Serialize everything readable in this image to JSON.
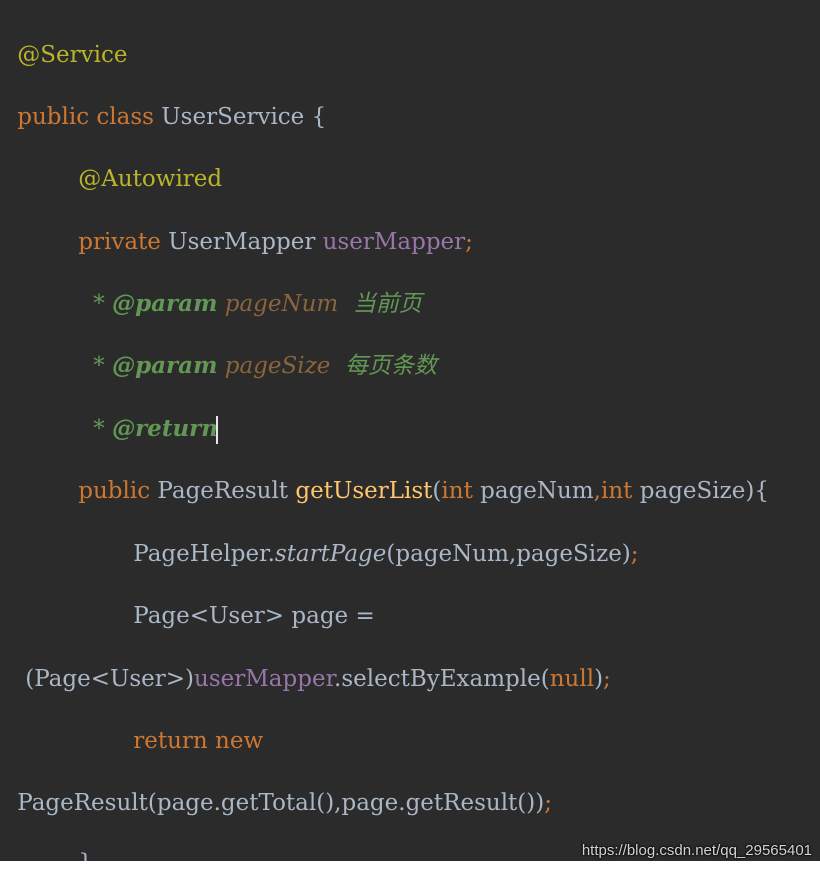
{
  "code": {
    "l1": {
      "annotation": "@Service"
    },
    "l2": {
      "kw1": "public",
      "kw2": "class",
      "name": "UserService",
      "brace": "{"
    },
    "l3": {
      "annotation": "@Autowired"
    },
    "l4": {
      "kw": "private",
      "type": "UserMapper",
      "field": "userMapper",
      "semi": ";"
    },
    "l5": {
      "star": "* ",
      "tag": "@param",
      "param": "pageNum",
      "desc": "  当前页"
    },
    "l6": {
      "star": "* ",
      "tag": "@param",
      "param": "pageSize",
      "desc": "  每页条数"
    },
    "l7": {
      "star": "* ",
      "tag": "@return"
    },
    "l8": {
      "kw": "public",
      "type": "PageResult",
      "method": "getUserList",
      "open": "(",
      "int1": "int",
      "p1": "pageNum",
      "comma": ",",
      "int2": "int",
      "p2": "pageSize",
      "close": "){"
    },
    "l9": {
      "cls": "PageHelper.",
      "method": "startPage",
      "args": "(pageNum,pageSize)",
      "semi": ";"
    },
    "l10": {
      "text": "Page<User> page ="
    },
    "l11": {
      "cast": "(Page<User>)",
      "field": "userMapper",
      "call": ".selectByExample(",
      "nullkw": "null",
      "close": ")",
      "semi": ";"
    },
    "l12": {
      "kw1": "return",
      "kw2": "new"
    },
    "l13": {
      "text": "PageResult(page.getTotal(),page.getResult())",
      "semi": ";"
    },
    "l14": {
      "brace": "}"
    }
  },
  "watermark": "https://blog.csdn.net/qq_29565401",
  "colors": {
    "background": "#2b2b2b",
    "keyword": "#cc7832",
    "annotation": "#bbb529",
    "field": "#9876aa",
    "method": "#ffc66d",
    "text": "#a9b7c6",
    "javadoc": "#629755",
    "javadoc_param": "#8a653b"
  }
}
